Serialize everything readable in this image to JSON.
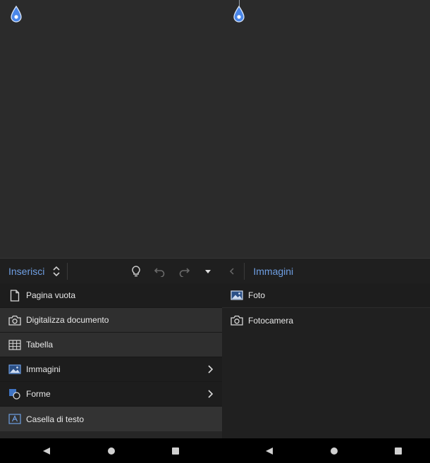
{
  "toolbar": {
    "insert_label": "Inserisci",
    "panel_title": "Immagini"
  },
  "menu": {
    "items": [
      {
        "label": "Pagina vuota",
        "icon": "blank-page-icon"
      },
      {
        "label": "Digitalizza documento",
        "icon": "camera-icon"
      },
      {
        "label": "Tabella",
        "icon": "table-icon"
      },
      {
        "label": "Immagini",
        "icon": "image-icon"
      },
      {
        "label": "Forme",
        "icon": "shapes-icon"
      },
      {
        "label": "Casella di testo",
        "icon": "text-box-icon"
      }
    ]
  },
  "submenu": {
    "items": [
      {
        "label": "Foto",
        "icon": "photo-icon"
      },
      {
        "label": "Fotocamera",
        "icon": "camera-icon"
      }
    ]
  },
  "colors": {
    "accent": "#6f9fe3",
    "handle": "#4a86e8",
    "background": "#2b2b2b"
  }
}
